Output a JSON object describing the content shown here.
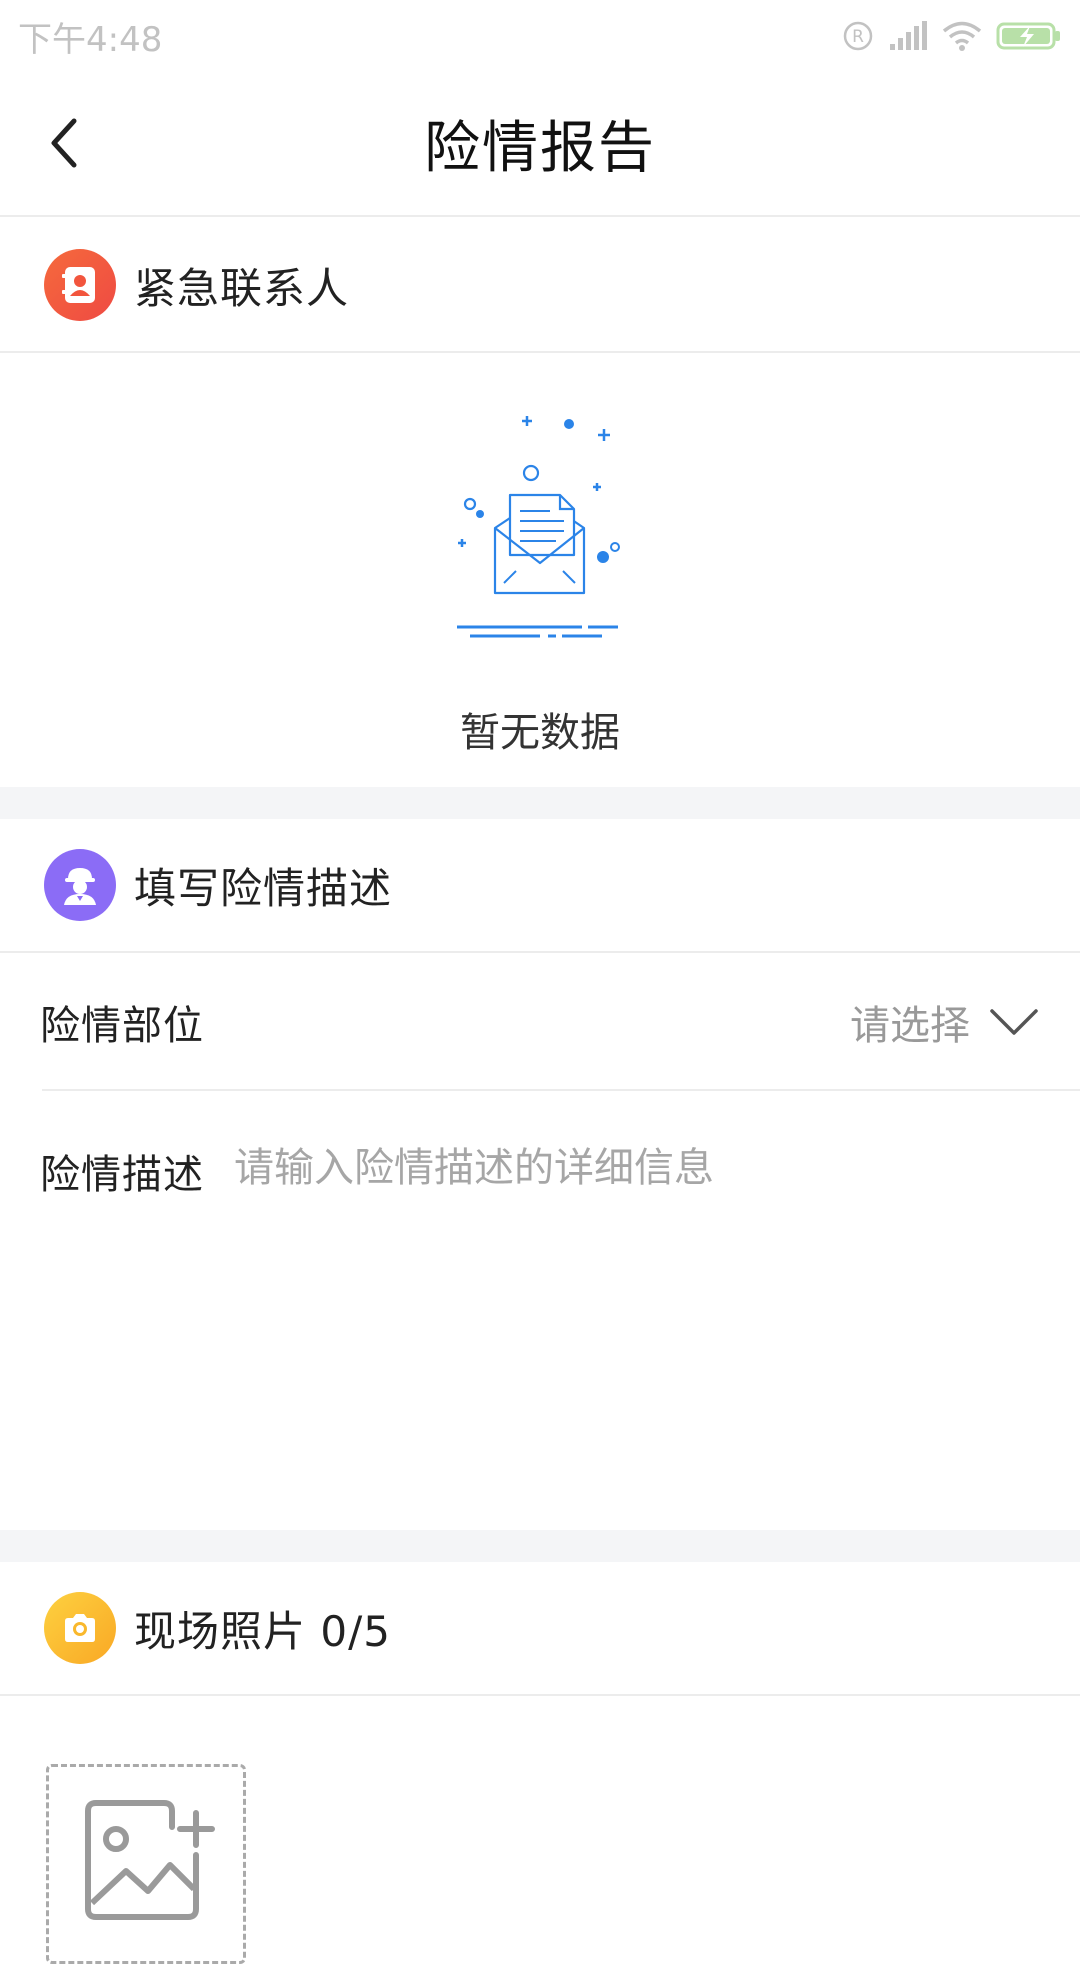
{
  "status_bar": {
    "time": "下午4:48",
    "icons": [
      "registered-icon",
      "signal-icon",
      "wifi-icon",
      "battery-charging-icon"
    ]
  },
  "nav": {
    "title": "险情报告",
    "back_icon": "chevron-left-icon"
  },
  "emergency_contacts": {
    "title": "紧急联系人",
    "icon": "contact-book-icon",
    "icon_color": "#f15a3a",
    "empty_text": "暂无数据",
    "empty_icon": "envelope-document-icon"
  },
  "description_section": {
    "title": "填写险情描述",
    "icon": "worker-icon",
    "icon_color": "#8b6cf6",
    "location": {
      "label": "险情部位",
      "value": "请选择",
      "icon": "chevron-down-icon"
    },
    "description": {
      "label": "险情描述",
      "placeholder": "请输入险情描述的详细信息",
      "value": ""
    }
  },
  "photos_section": {
    "title": "现场照片 0/5",
    "icon": "camera-icon",
    "icon_color": "#fbbf24",
    "add_icon": "add-image-icon"
  },
  "colors": {
    "accent_blue": "#2b84e8",
    "divider": "#ececec",
    "band": "#f4f5f7"
  }
}
